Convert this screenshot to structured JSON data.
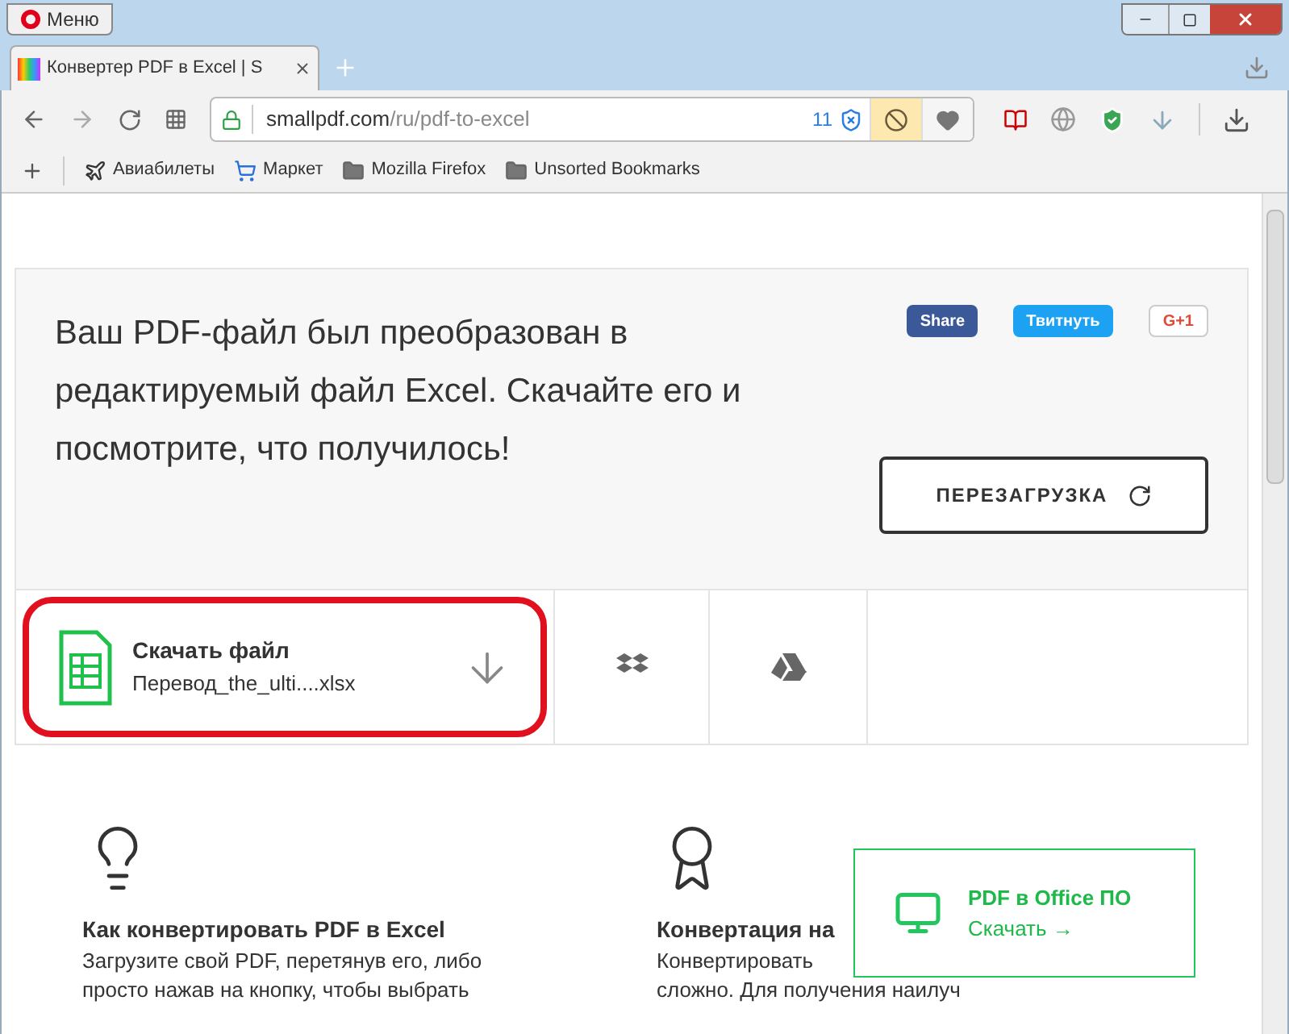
{
  "browser": {
    "menu_label": "Меню",
    "tab": {
      "title": "Конвертер PDF в Excel | S",
      "selected": true
    },
    "address": {
      "domain": "smallpdf.com",
      "path": "/ru/pdf-to-excel",
      "blocked_count": "11"
    },
    "bookmarks": [
      {
        "label": "Авиабилеты",
        "kind": "plane"
      },
      {
        "label": "Маркет",
        "kind": "cart"
      },
      {
        "label": "Mozilla Firefox",
        "kind": "folder"
      },
      {
        "label": "Unsorted Bookmarks",
        "kind": "folder"
      }
    ]
  },
  "result": {
    "message": "Ваш PDF-файл был преобразован в редактируемый файл Excel. Скачайте его и посмотрите, что получилось!",
    "share": [
      {
        "label": "Share",
        "kind": "facebook"
      },
      {
        "label": "Твитнуть",
        "kind": "twitter"
      },
      {
        "label": "G+1",
        "kind": "google"
      }
    ],
    "restart_label": "ПЕРЕЗАГРУЗКА"
  },
  "download": {
    "title": "Скачать файл",
    "file": "Перевод_the_ulti....xlsx",
    "highlighted": true
  },
  "features": [
    {
      "kind": "bulb",
      "title": "Как конвертировать PDF в Excel",
      "lines": [
        "Загрузите свой PDF, перетянув его, либо",
        "просто нажав на кнопку, чтобы выбрать"
      ]
    },
    {
      "kind": "medal",
      "title": "Конвертация на",
      "lines": [
        "Конвертировать",
        "сложно. Для получения наилуч"
      ]
    }
  ],
  "promo": {
    "title": "PDF в Office ПО",
    "link": "Скачать →"
  }
}
